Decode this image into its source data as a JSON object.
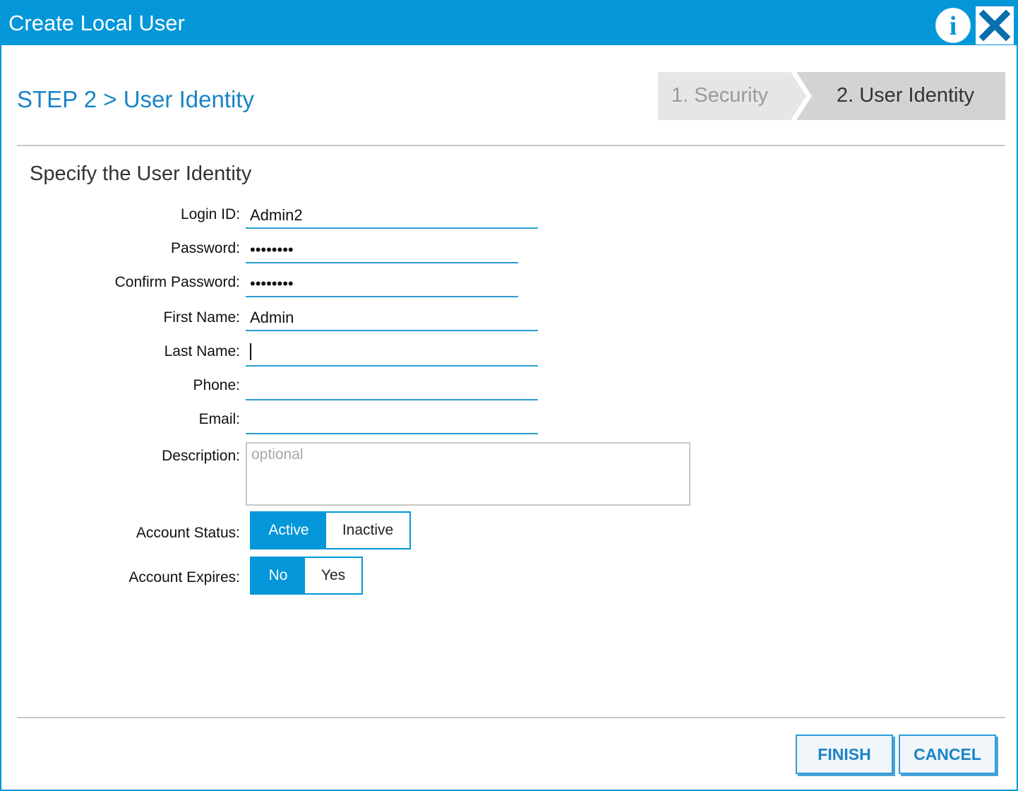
{
  "window": {
    "title": "Create Local User"
  },
  "header": {
    "step_heading": "STEP 2 > User Identity",
    "breadcrumbs": [
      {
        "label": "1. Security",
        "active": false
      },
      {
        "label": "2. User Identity",
        "active": true
      }
    ]
  },
  "form": {
    "section_title": "Specify the User Identity",
    "fields": {
      "login_id": {
        "label": "Login ID:",
        "value": "Admin2"
      },
      "password": {
        "label": "Password:",
        "value": "12345678"
      },
      "confirm_password": {
        "label": "Confirm Password:",
        "value": "12345678"
      },
      "first_name": {
        "label": "First Name:",
        "value": "Admin"
      },
      "last_name": {
        "label": "Last Name:",
        "value": ""
      },
      "phone": {
        "label": "Phone:",
        "value": ""
      },
      "email": {
        "label": "Email:",
        "value": ""
      },
      "description": {
        "label": "Description:",
        "value": "",
        "placeholder": "optional"
      }
    },
    "account_status": {
      "label": "Account Status:",
      "options": [
        "Active",
        "Inactive"
      ],
      "selected": "Active"
    },
    "account_expires": {
      "label": "Account Expires:",
      "options": [
        "No",
        "Yes"
      ],
      "selected": "No"
    }
  },
  "footer": {
    "finish_label": "FINISH",
    "cancel_label": "CANCEL"
  },
  "colors": {
    "accent": "#0396d8",
    "heading_blue": "#1a84c7",
    "field_underline": "#2d9bd6"
  },
  "icons": {
    "info": "info-icon",
    "close": "close-icon"
  }
}
